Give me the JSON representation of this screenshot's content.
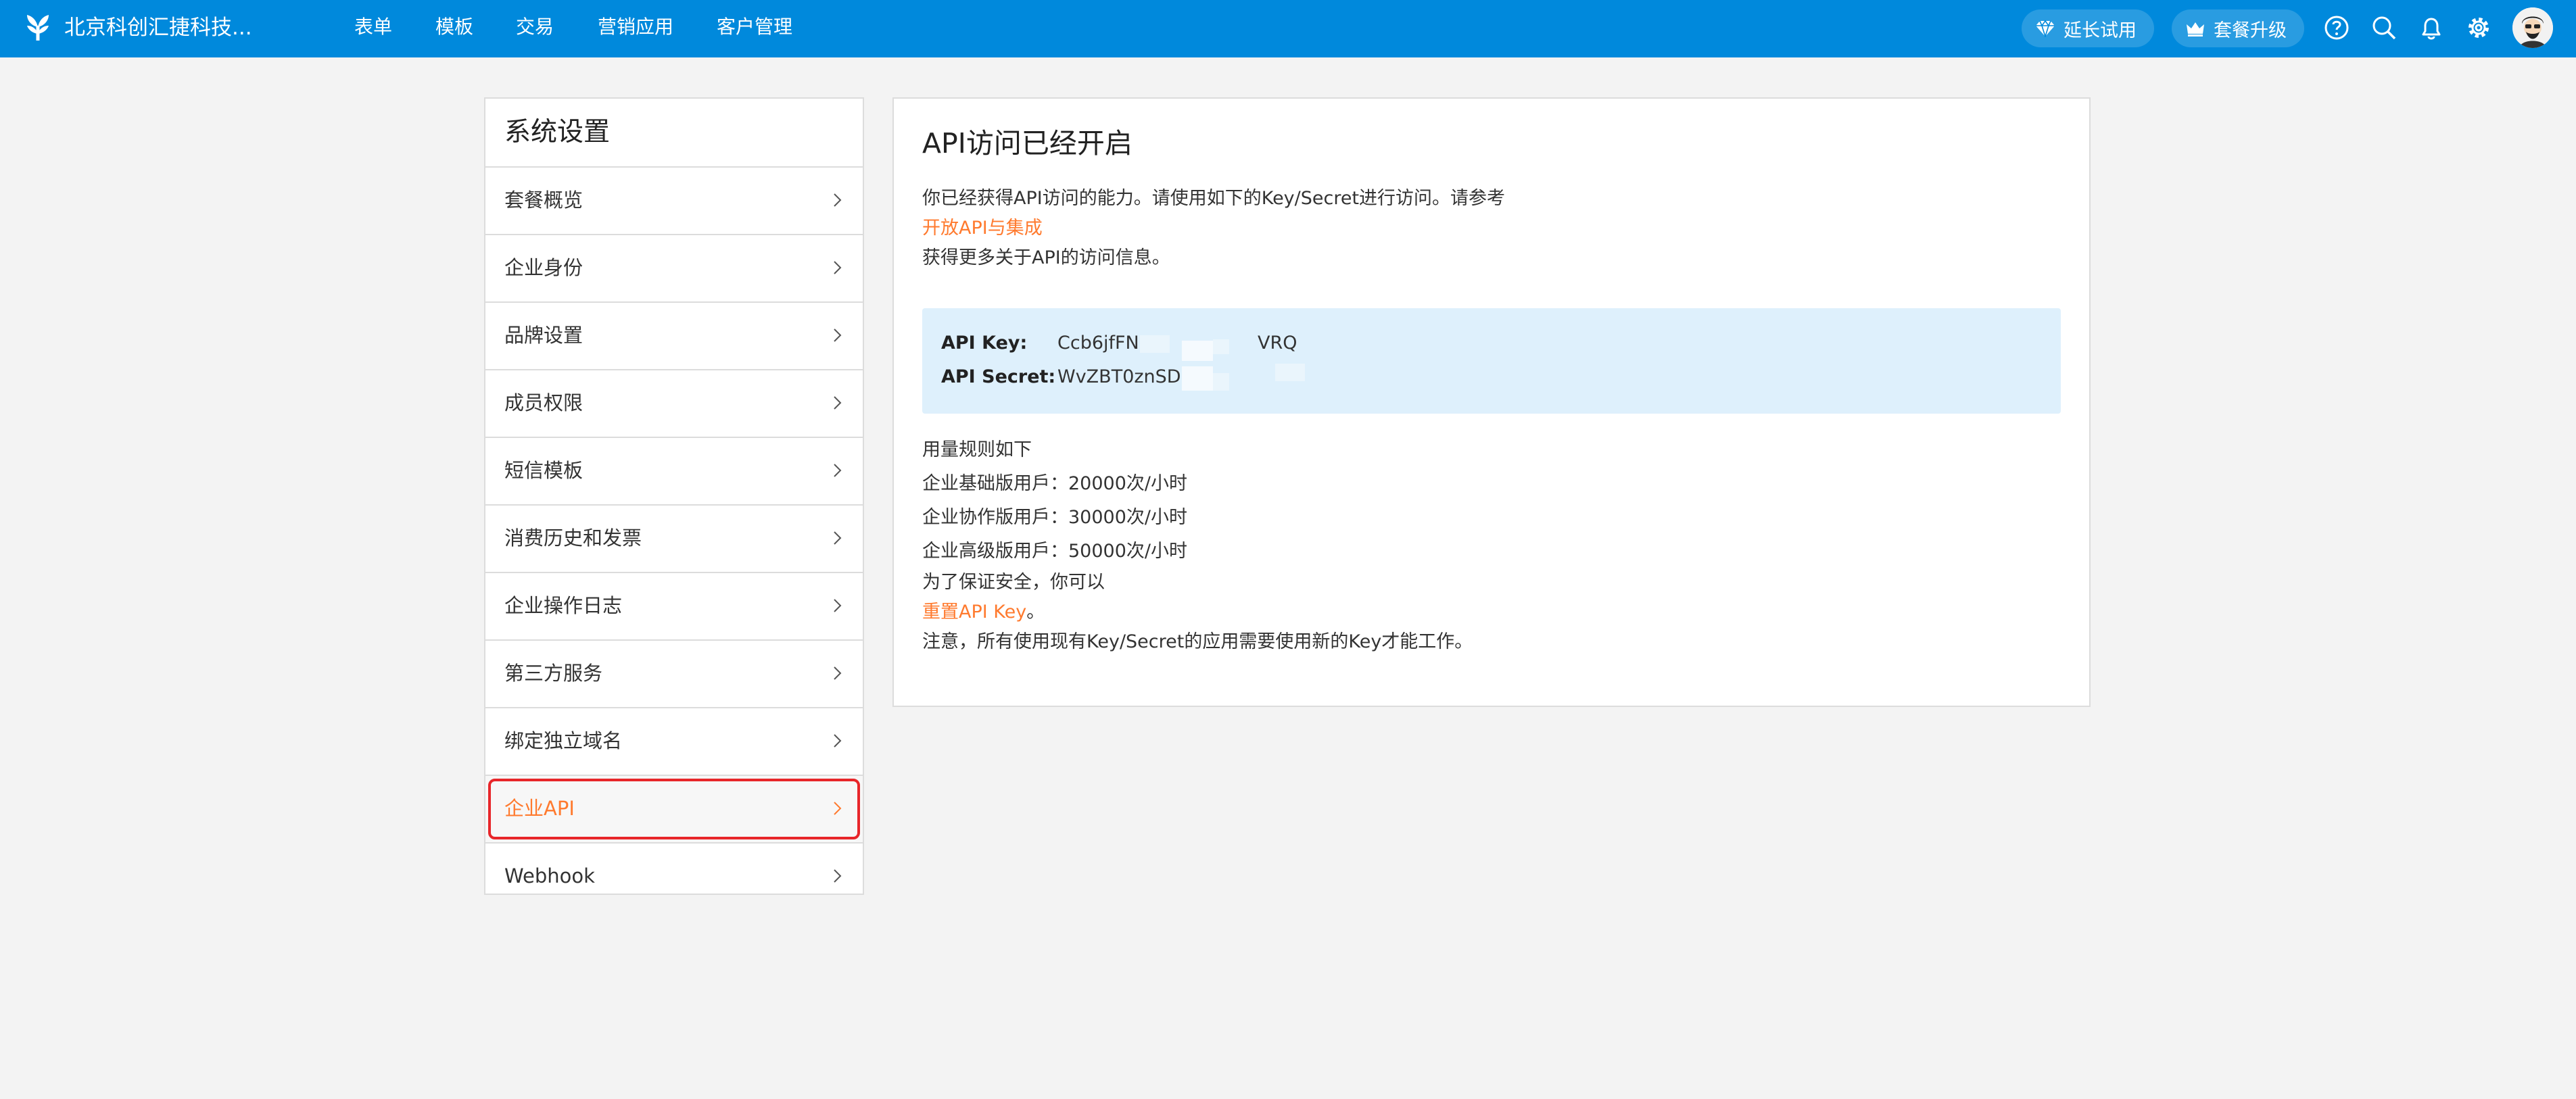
{
  "topbar": {
    "company": "北京科创汇捷科技...",
    "nav": [
      "表单",
      "模板",
      "交易",
      "营销应用",
      "客户管理"
    ],
    "extend_trial": "延长试用",
    "upgrade": "套餐升级",
    "icons": [
      "help-icon",
      "search-icon",
      "bell-icon",
      "settings-icon"
    ]
  },
  "sidebar": {
    "title": "系统设置",
    "items": [
      "套餐概览",
      "企业身份",
      "品牌设置",
      "成员权限",
      "短信模板",
      "消费历史和发票",
      "企业操作日志",
      "第三方服务",
      "绑定独立域名",
      "企业API",
      "Webhook"
    ],
    "active": "企业API"
  },
  "main": {
    "title": "API访问已经开启",
    "intro": "你已经获得API访问的能力。请使用如下的Key/Secret进行访问。请参考",
    "doc_link": "开放API与集成",
    "intro_tail": "获得更多关于API的访问信息。",
    "api_key_label": "API Key:",
    "api_key_value_start": "Ccb6jfFN",
    "api_key_value_end": "VRQ",
    "api_secret_label": "API Secret:",
    "api_secret_value_start": "WvZBT0znSDs",
    "usage_title": "用量规则如下",
    "usage": [
      "企业基础版用戶：20000次/小时",
      "企业协作版用戶：30000次/小时",
      "企业高级版用戶：50000次/小时"
    ],
    "security": "为了保证安全，你可以",
    "reset_link": "重置API Key",
    "reset_tail": "。",
    "note": "注意，所有使用现有Key/Secret的应用需要使用新的Key才能工作。"
  },
  "colors": {
    "topbar": "#0089dc",
    "accent": "#ff7a2e",
    "highlight": "#e8262a",
    "keybox": "#def0fc"
  }
}
